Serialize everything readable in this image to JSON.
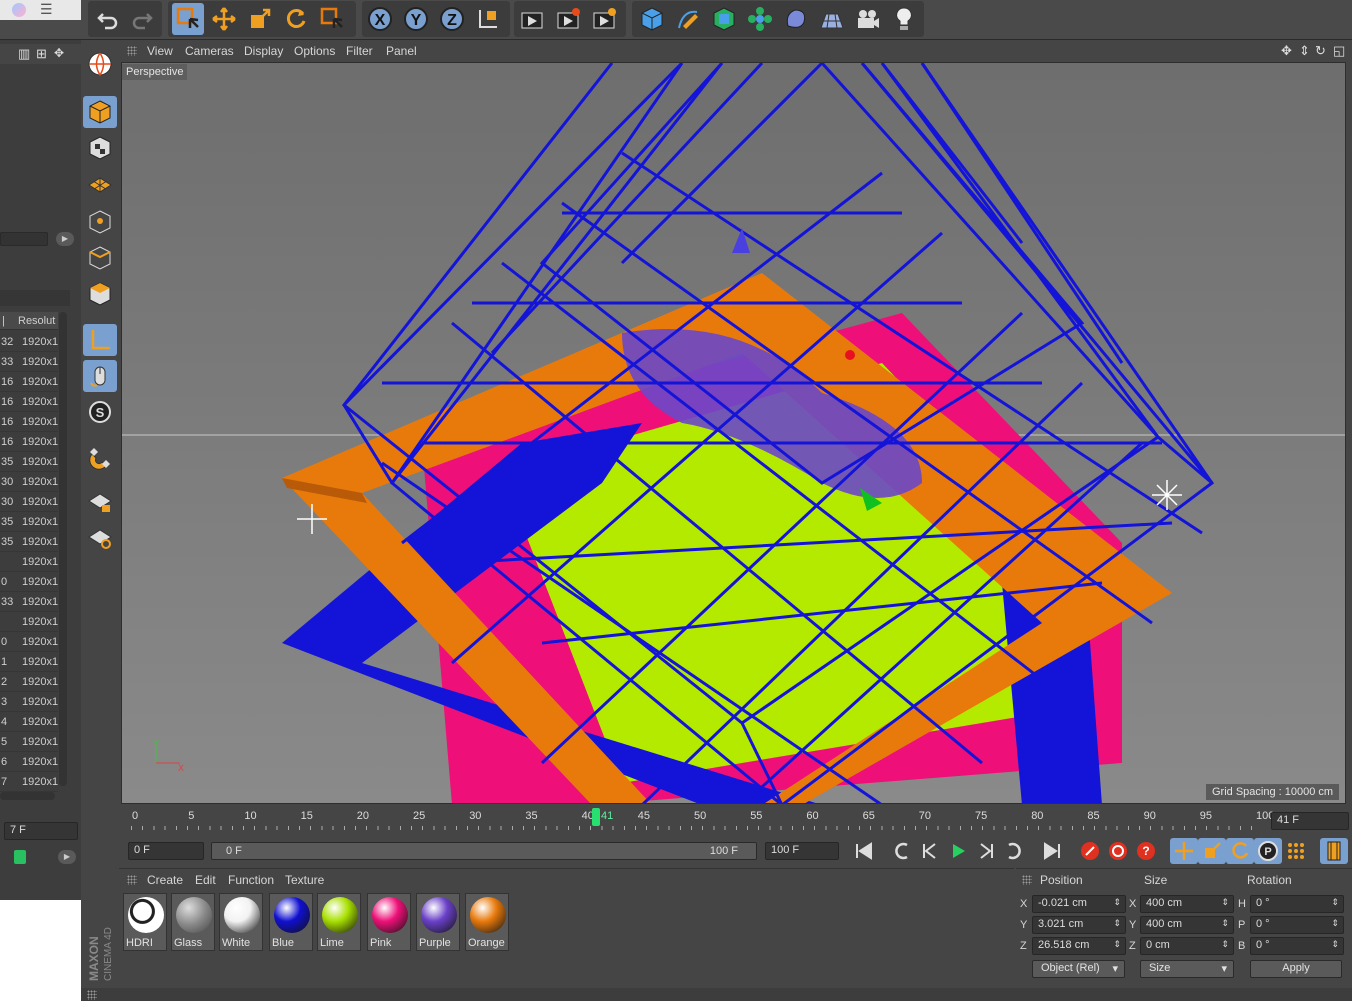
{
  "toolbar": {
    "tools": [
      "undo-icon",
      "redo-icon",
      "live-selection-icon",
      "move-icon",
      "scale-icon",
      "rotate-icon",
      "select-icon",
      "x-axis-lock-icon",
      "y-axis-lock-icon",
      "z-axis-lock-icon",
      "coordinate-system-icon",
      "render-view-icon",
      "render-picture-viewer-icon",
      "render-settings-icon",
      "cube-icon",
      "pen-spline-icon",
      "subdivision-icon",
      "array-icon",
      "deformer-icon",
      "floor-icon",
      "camera-icon",
      "light-icon"
    ],
    "axis_labels": [
      "X",
      "Y",
      "Z"
    ]
  },
  "viewport": {
    "menu": [
      "View",
      "Cameras",
      "Display",
      "Options",
      "Filter",
      "Panel"
    ],
    "label": "Perspective",
    "grid_spacing": "Grid Spacing : 10000 cm"
  },
  "left_panel": {
    "column_header": "Resolut",
    "rows": [
      {
        "a": "32",
        "b": "1920x1"
      },
      {
        "a": "33",
        "b": "1920x1"
      },
      {
        "a": "16",
        "b": "1920x1"
      },
      {
        "a": "16",
        "b": "1920x1"
      },
      {
        "a": "16",
        "b": "1920x1"
      },
      {
        "a": "16",
        "b": "1920x1"
      },
      {
        "a": "35",
        "b": "1920x1"
      },
      {
        "a": "30",
        "b": "1920x1"
      },
      {
        "a": "30",
        "b": "1920x1"
      },
      {
        "a": "35",
        "b": "1920x1"
      },
      {
        "a": "35",
        "b": "1920x1"
      },
      {
        "a": "",
        "b": "1920x1"
      },
      {
        "a": "0",
        "b": "1920x1"
      },
      {
        "a": "33",
        "b": "1920x1"
      },
      {
        "a": "",
        "b": "1920x1"
      },
      {
        "a": "0",
        "b": "1920x1"
      },
      {
        "a": "1",
        "b": "1920x1"
      },
      {
        "a": "2",
        "b": "1920x1"
      },
      {
        "a": "3",
        "b": "1920x1"
      },
      {
        "a": "4",
        "b": "1920x1"
      },
      {
        "a": "5",
        "b": "1920x1"
      },
      {
        "a": "6",
        "b": "1920x1"
      },
      {
        "a": "7",
        "b": "1920x1"
      }
    ],
    "frame_field": "7 F"
  },
  "timeline": {
    "ticks": [
      "0",
      "5",
      "10",
      "15",
      "20",
      "25",
      "30",
      "35",
      "40",
      "45",
      "50",
      "55",
      "60",
      "65",
      "70",
      "75",
      "80",
      "85",
      "90",
      "95",
      "100"
    ],
    "current": "41",
    "current_field": "41 F"
  },
  "controls": {
    "start": "0 F",
    "range_start": "0 F",
    "range_end": "100 F",
    "end": "100 F"
  },
  "materials": {
    "menu": [
      "Create",
      "Edit",
      "Function",
      "Texture"
    ],
    "items": [
      {
        "name": "HDRI",
        "color": "#ffffff"
      },
      {
        "name": "Glass",
        "color": "#a0a0a0"
      },
      {
        "name": "White",
        "color": "#f2f2f2"
      },
      {
        "name": "Blue",
        "color": "#1010d0"
      },
      {
        "name": "Lime",
        "color": "#a8e000"
      },
      {
        "name": "Pink",
        "color": "#ee1078"
      },
      {
        "name": "Purple",
        "color": "#6a40c8"
      },
      {
        "name": "Orange",
        "color": "#e87a0c"
      }
    ]
  },
  "coordinates": {
    "headers": [
      "Position",
      "Size",
      "Rotation"
    ],
    "rows": [
      {
        "axis": "X",
        "pos": "-0.021 cm",
        "saxis": "X",
        "size": "400 cm",
        "raxis": "H",
        "rot": "0 °"
      },
      {
        "axis": "Y",
        "pos": "3.021 cm",
        "saxis": "Y",
        "size": "400 cm",
        "raxis": "P",
        "rot": "0 °"
      },
      {
        "axis": "Z",
        "pos": "26.518 cm",
        "saxis": "Z",
        "size": "0 cm",
        "raxis": "B",
        "rot": "0 °"
      }
    ],
    "mode": "Object (Rel)",
    "size_mode": "Size",
    "apply": "Apply"
  },
  "logo": {
    "brand": "MAXON",
    "product": "CINEMA 4D"
  },
  "colors": {
    "wire_blue": "#1414d8",
    "orange": "#e87a0c",
    "pink": "#ee1078",
    "lime": "#b4ea00",
    "purple": "#6a48c8",
    "selection": "#7aa0d0"
  }
}
